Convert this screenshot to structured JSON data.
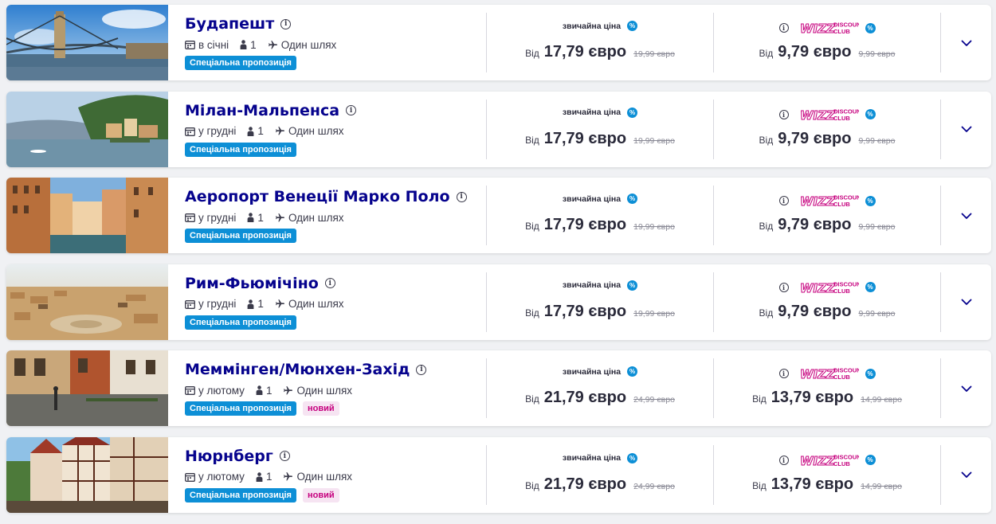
{
  "labels": {
    "regular_price": "звичайна ціна",
    "from": "Від",
    "discount_club_top": "DISCOUNT",
    "discount_club_bottom": "CLUB",
    "one_way": "Один шлях",
    "passengers": "1",
    "special_offer": "Спеціальна пропозиція",
    "new": "новий",
    "percent_symbol": "%",
    "info_symbol": "i"
  },
  "colors": {
    "brand_navy": "#06038d",
    "brand_magenta": "#c6007e",
    "accent_blue": "#0d8fd6"
  },
  "icons": {
    "calendar": "calendar-icon",
    "person": "person-icon",
    "plane": "plane-icon",
    "info": "info-icon",
    "percent": "percent-icon",
    "chevron": "chevron-down-icon"
  },
  "offers": [
    {
      "city": "Будапешт",
      "month": "в січні",
      "regular_price": "17,79 євро",
      "regular_old": "19,99 євро",
      "club_price": "9,79 євро",
      "club_old": "9,99 євро",
      "is_new": false,
      "image": "budapest-bridge"
    },
    {
      "city": "Мілан-Мальпенса",
      "month": "у грудні",
      "regular_price": "17,79 євро",
      "regular_old": "19,99 євро",
      "club_price": "9,79 євро",
      "club_old": "9,99 євро",
      "is_new": false,
      "image": "lake-como"
    },
    {
      "city": "Аеропорт Венеції Марко Поло",
      "month": "у грудні",
      "regular_price": "17,79 євро",
      "regular_old": "19,99 євро",
      "club_price": "9,79 євро",
      "club_old": "9,99 євро",
      "is_new": false,
      "image": "venice-canal"
    },
    {
      "city": "Рим-Фьюмічіно",
      "month": "у грудні",
      "regular_price": "17,79 євро",
      "regular_old": "19,99 євро",
      "club_price": "9,79 євро",
      "club_old": "9,99 євро",
      "is_new": false,
      "image": "rome-aerial"
    },
    {
      "city": "Меммінген/Мюнхен-Захід",
      "month": "у лютому",
      "regular_price": "21,79 євро",
      "regular_old": "24,99 євро",
      "club_price": "13,79 євро",
      "club_old": "14,99 євро",
      "is_new": true,
      "image": "memmingen-street"
    },
    {
      "city": "Нюрнберг",
      "month": "у лютому",
      "regular_price": "21,79 євро",
      "regular_old": "24,99 євро",
      "club_price": "13,79 євро",
      "club_old": "14,99 євро",
      "is_new": true,
      "image": "nuremberg-houses"
    }
  ]
}
